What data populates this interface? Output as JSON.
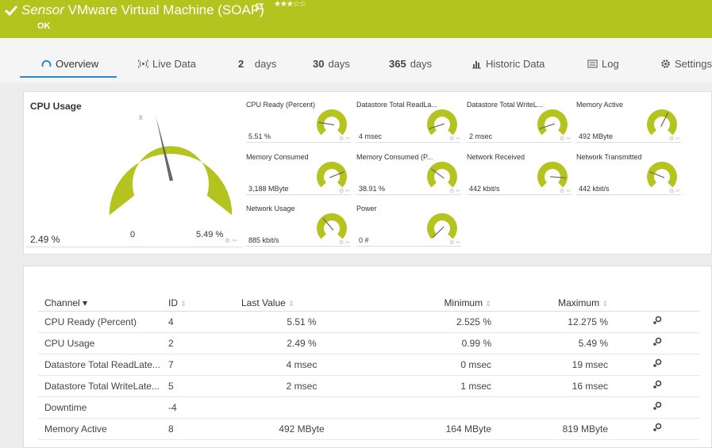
{
  "header": {
    "sensor_word": "Sensor",
    "title": "VMware Virtual Machine (SOAP)",
    "status": "OK",
    "stars": "★★★☆☆",
    "colors": {
      "header_bg": "#b4c31e",
      "gauge_green": "#b4c31e",
      "active_tab": "#2b8ac6"
    }
  },
  "tabs": [
    {
      "label": "Overview",
      "icon": "gauge-icon"
    },
    {
      "label": "Live Data",
      "icon": "live-signal-icon"
    },
    {
      "num": "2",
      "label": "days"
    },
    {
      "num": "30",
      "label": "days"
    },
    {
      "num": "365",
      "label": "days"
    },
    {
      "label": "Historic Data",
      "icon": "bar-chart-icon"
    },
    {
      "label": "Log",
      "icon": "log-list-icon"
    },
    {
      "label": "Settings",
      "icon": "gear-icon"
    }
  ],
  "big_gauge": {
    "title": "CPU Usage",
    "value": "2.49 %",
    "min": "0",
    "max": "5.49 %",
    "level": 0.45
  },
  "gauges": [
    {
      "label": "CPU Ready (Percent)",
      "value": "5.51 %",
      "level": 0.2
    },
    {
      "label": "Datastore Total ReadLa...",
      "value": "4 msec",
      "level": 0.1
    },
    {
      "label": "Datastore Total WriteL...",
      "value": "2 msec",
      "level": 0.1
    },
    {
      "label": "Memory Active",
      "value": "492 MByte",
      "level": 0.6
    },
    {
      "label": "Memory Consumed",
      "value": "3,188 MByte",
      "level": 0.75
    },
    {
      "label": "Memory Consumed (P...",
      "value": "38.91 %",
      "level": 0.3
    },
    {
      "label": "Network Received",
      "value": "442 kbit/s",
      "level": 0.85
    },
    {
      "label": "Network Transmitted",
      "value": "442 kbit/s",
      "level": 0.25
    },
    {
      "label": "Network Usage",
      "value": "885 kbit/s",
      "level": 0.35
    },
    {
      "label": "Power",
      "value": "0 #",
      "level": 0.0
    }
  ],
  "table": {
    "headers": {
      "channel": "Channel",
      "id": "ID",
      "last": "Last Value",
      "min": "Minimum",
      "max": "Maximum"
    },
    "rows": [
      {
        "channel": "CPU Ready (Percent)",
        "id": "4",
        "last": "5.51 %",
        "min": "2.525 %",
        "max": "12.275 %"
      },
      {
        "channel": "CPU Usage",
        "id": "2",
        "last": "2.49 %",
        "min": "0.99 %",
        "max": "5.49 %"
      },
      {
        "channel": "Datastore Total ReadLate...",
        "id": "7",
        "last": "4 msec",
        "min": "0 msec",
        "max": "19 msec"
      },
      {
        "channel": "Datastore Total WriteLate...",
        "id": "5",
        "last": "2 msec",
        "min": "1 msec",
        "max": "16 msec"
      },
      {
        "channel": "Downtime",
        "id": "-4",
        "last": "",
        "min": "",
        "max": ""
      },
      {
        "channel": "Memory Active",
        "id": "8",
        "last": "492 MByte",
        "min": "164 MByte",
        "max": "819 MByte"
      }
    ]
  }
}
